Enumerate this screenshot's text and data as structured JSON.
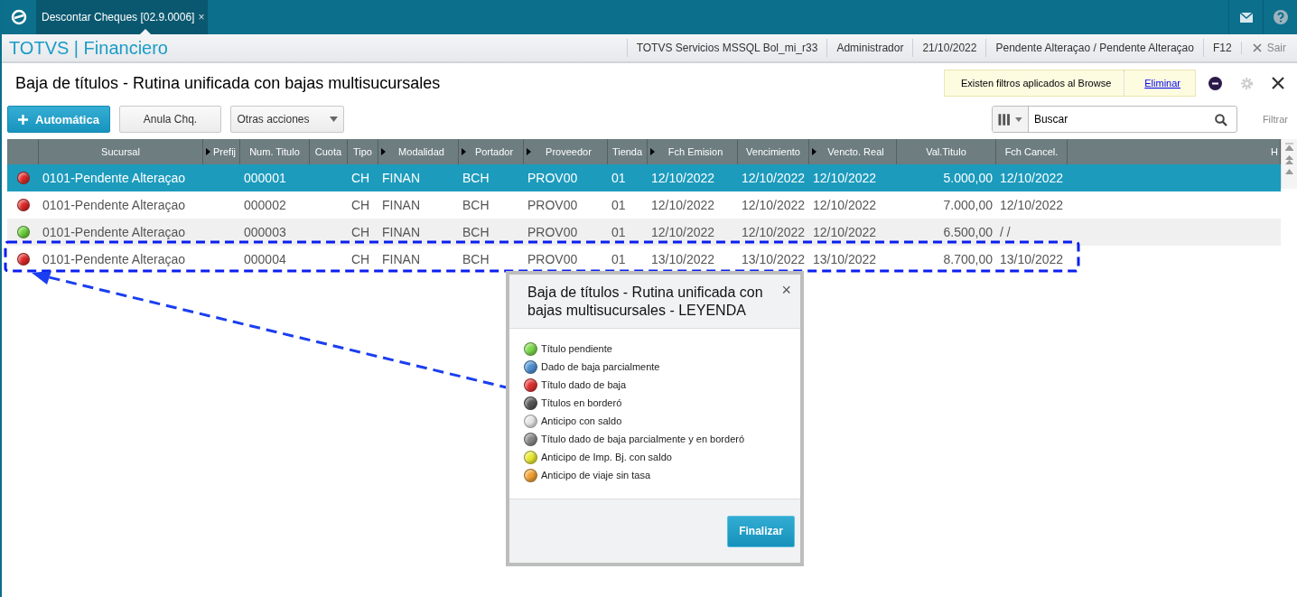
{
  "tab": {
    "title": "Descontar Cheques [02.9.0006]",
    "close": "×"
  },
  "app_title": "TOTVS | Financiero",
  "status_items": [
    "TOTVS Servicios MSSQL Bol_mi_r33",
    "Administrador",
    "21/10/2022",
    "Pendente Alteraçao / Pendente Alteraçao",
    "F12"
  ],
  "exit": "Sair",
  "page_title": "Baja de títulos - Rutina unificada con bajas multisucursales",
  "filter_notice": {
    "text": "Existen filtros aplicados al Browse",
    "link": "Eliminar"
  },
  "buttons": [
    {
      "label": "Automática",
      "kind": "primary"
    },
    {
      "label": "Anula Chq.",
      "kind": "plain"
    },
    {
      "label": "Otras acciones",
      "kind": "menu"
    }
  ],
  "search": {
    "value": "Buscar"
  },
  "filter_label": "Filtrar",
  "table": {
    "columns": [
      {
        "label": "Sucursal",
        "arrow": false
      },
      {
        "label": "Prefij",
        "arrow": true
      },
      {
        "label": "Num. Titulo",
        "arrow": false
      },
      {
        "label": "Cuota",
        "arrow": false
      },
      {
        "label": "Tipo",
        "arrow": false
      },
      {
        "label": "Modalidad",
        "arrow": true
      },
      {
        "label": "Portador",
        "arrow": true
      },
      {
        "label": "Proveedor",
        "arrow": true
      },
      {
        "label": "Tienda",
        "arrow": false
      },
      {
        "label": "Fch Emision",
        "arrow": true
      },
      {
        "label": "Vencimiento",
        "arrow": false
      },
      {
        "label": "Vencto. Real",
        "arrow": true
      },
      {
        "label": "Val.Titulo",
        "arrow": false
      },
      {
        "label": "Fch Cancel.",
        "arrow": false
      },
      {
        "label": "H",
        "arrow": false
      }
    ],
    "rows": [
      {
        "selected": true,
        "color": "#e02828",
        "cells": [
          "0101-Pendente Alteraçao",
          "",
          "000001",
          "",
          "CH",
          "FINAN",
          "BCH",
          "PROV00",
          "01",
          "12/10/2022",
          "12/10/2022",
          "12/10/2022",
          "5.000,00",
          "12/10/2022"
        ]
      },
      {
        "selected": false,
        "color": "#e02828",
        "cells": [
          "0101-Pendente Alteraçao",
          "",
          "000002",
          "",
          "CH",
          "FINAN",
          "BCH",
          "PROV00",
          "01",
          "12/10/2022",
          "12/10/2022",
          "12/10/2022",
          "7.000,00",
          "12/10/2022"
        ]
      },
      {
        "selected": false,
        "color": "#6cd038",
        "cells": [
          "0101-Pendente Alteraçao",
          "",
          "000003",
          "",
          "CH",
          "FINAN",
          "BCH",
          "PROV00",
          "01",
          "12/10/2022",
          "12/10/2022",
          "12/10/2022",
          "6.500,00",
          " /  /"
        ]
      },
      {
        "selected": false,
        "color": "#e02828",
        "cells": [
          "0101-Pendente Alteraçao",
          "",
          "000004",
          "",
          "CH",
          "FINAN",
          "BCH",
          "PROV00",
          "01",
          "13/10/2022",
          "13/10/2022",
          "13/10/2022",
          "8.700,00",
          "13/10/2022"
        ]
      }
    ]
  },
  "legend_dialog": {
    "title": "Baja de títulos - Rutina unificada con bajas multisucursales - LEYENDA",
    "close": "×",
    "items": [
      {
        "label": "Título pendiente",
        "color": "#7ad84a"
      },
      {
        "label": "Dado de baja parcialmente",
        "color": "#4d8fd0"
      },
      {
        "label": "Título dado de baja",
        "color": "#e03030"
      },
      {
        "label": "Títulos en borderó",
        "color": "#555555"
      },
      {
        "label": "Anticipo con saldo",
        "color": "#e6e6e6"
      },
      {
        "label": "Título dado de baja parcialmente y en borderó",
        "color": "#888888"
      },
      {
        "label": "Anticipo de Imp. Bj. con saldo",
        "color": "#e8e830"
      },
      {
        "label": "Anticipo de viaje sin tasa",
        "color": "#f0a030"
      }
    ],
    "button": "Finalizar"
  }
}
